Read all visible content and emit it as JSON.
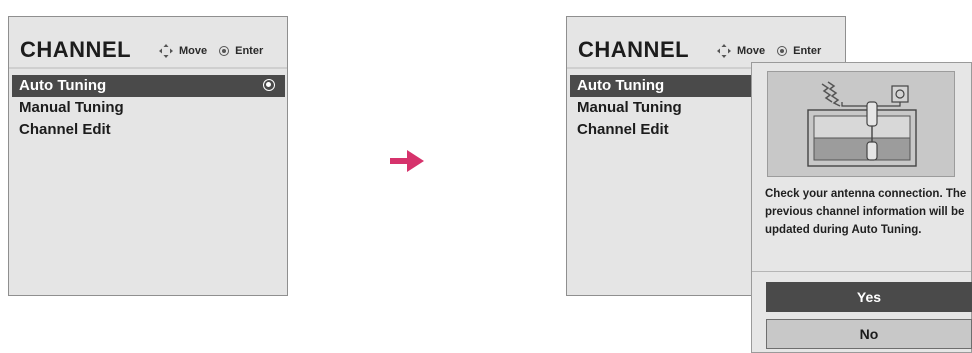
{
  "left_screen": {
    "title": "CHANNEL",
    "hints": {
      "move_label": "Move",
      "enter_label": "Enter"
    },
    "menu": [
      {
        "label": "Auto Tuning",
        "selected": true
      },
      {
        "label": "Manual Tuning",
        "selected": false
      },
      {
        "label": "Channel Edit",
        "selected": false
      }
    ]
  },
  "right_screen": {
    "title": "CHANNEL",
    "hints": {
      "move_label": "Move",
      "enter_label": "Enter"
    },
    "menu": [
      {
        "label": "Auto Tuning",
        "selected": true
      },
      {
        "label": "Manual Tuning",
        "selected": false
      },
      {
        "label": "Channel Edit",
        "selected": false
      }
    ],
    "dialog": {
      "illustration": "antenna-connection-diagram",
      "message": "Check your antenna connection. The previous channel information will be updated during Auto Tuning.",
      "yes_label": "Yes",
      "no_label": "No",
      "selected_button": "Yes"
    }
  },
  "colors": {
    "panel_bg": "#e5e5e5",
    "selection_bg": "#4a4a4a",
    "arrow": "#d6336c",
    "border": "#8f8f8f"
  }
}
